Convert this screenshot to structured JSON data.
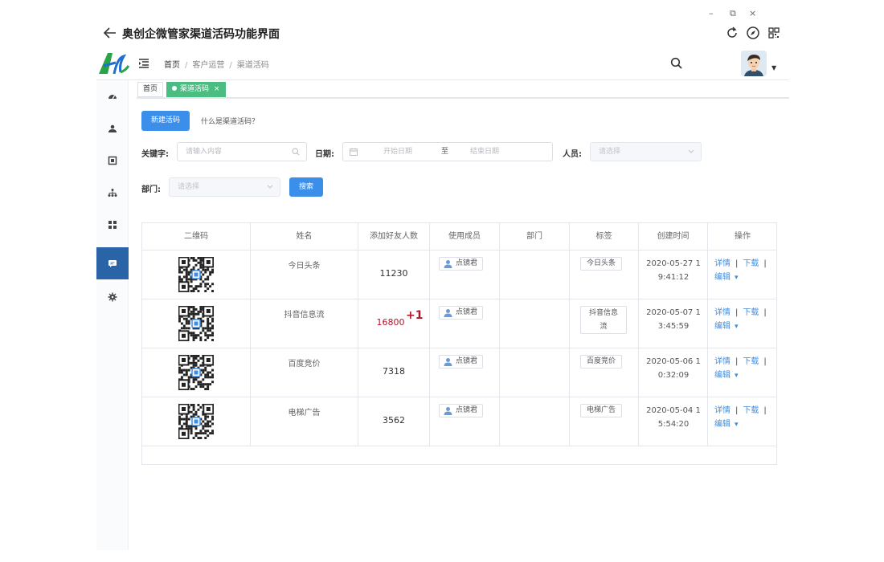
{
  "window": {
    "title": "奥创企微管家渠道活码功能界面",
    "controls": {
      "minimize": "–",
      "restore": "⧉",
      "close": "×"
    }
  },
  "header": {
    "breadcrumb": [
      "首页",
      "客户运营",
      "渠道活码"
    ]
  },
  "tabs": [
    {
      "label": "首页",
      "active": false
    },
    {
      "label": "渠道活码",
      "active": true,
      "close": "×"
    }
  ],
  "toolbar": {
    "new_button": "新建活码",
    "help_link": "什么是渠道活码？"
  },
  "filters": {
    "keyword_label": "关键字:",
    "keyword_placeholder": "请输入内容",
    "date_label": "日期:",
    "start_placeholder": "开始日期",
    "range_sep": "至",
    "end_placeholder": "结束日期",
    "person_label": "人员:",
    "person_placeholder": "请选择",
    "dept_label": "部门:",
    "dept_placeholder": "请选择",
    "search_button": "搜索"
  },
  "table": {
    "columns": [
      "二维码",
      "姓名",
      "添加好友人数",
      "使用成员",
      "部门",
      "标签",
      "创建时间",
      "操作"
    ],
    "rows": [
      {
        "name": "今日头条",
        "count": "11230",
        "badge": "",
        "member": "点镜君",
        "dept": "",
        "tag": [
          "今日头条"
        ],
        "time": [
          "2020-05-27 1",
          "9:41:12"
        ]
      },
      {
        "name": "抖音信息流",
        "count": "16800",
        "badge": "+1",
        "member": "点镜君",
        "dept": "",
        "tag": [
          "抖音信息",
          "流"
        ],
        "time": [
          "2020-05-07 1",
          "3:45:59"
        ]
      },
      {
        "name": "百度竞价",
        "count": "7318",
        "badge": "",
        "member": "点镜君",
        "dept": "",
        "tag": [
          "百度竞价"
        ],
        "time": [
          "2020-05-06 1",
          "0:32:09"
        ]
      },
      {
        "name": "电梯广告",
        "count": "3562",
        "badge": "",
        "member": "点镜君",
        "dept": "",
        "tag": [
          "电梯广告"
        ],
        "time": [
          "2020-05-04 1",
          "5:54:20"
        ]
      }
    ],
    "ops": {
      "detail": "详情",
      "download": "下载",
      "edit": "编辑",
      "sep": "|",
      "caret": "▾"
    }
  },
  "colors": {
    "primary": "#3b8fea",
    "active_tab": "#4bbd82",
    "sidebar_active": "#2a63a6",
    "highlight_count": "#b0142b"
  }
}
